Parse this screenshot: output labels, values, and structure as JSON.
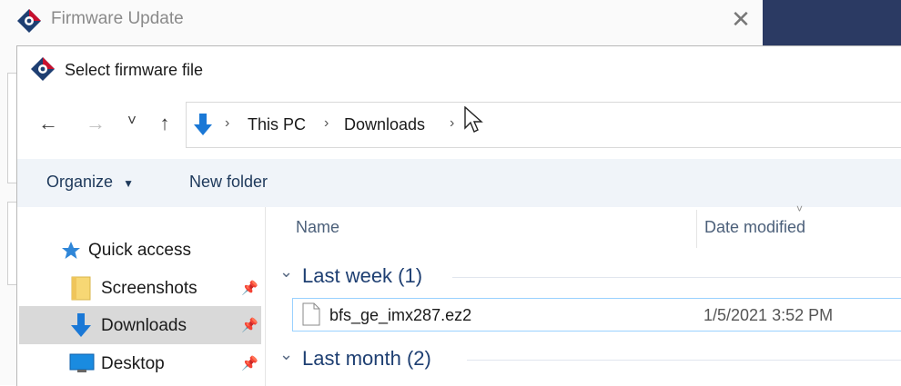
{
  "background_app": {
    "title": "Firmware Update",
    "close_glyph": "✕",
    "accent": "#c8102e"
  },
  "dialog": {
    "title": "Select firmware file",
    "nav": {
      "back": "←",
      "forward": "→",
      "recent": "˅",
      "up": "↑"
    },
    "breadcrumb": [
      "This PC",
      "Downloads"
    ],
    "toolbar": {
      "organize": "Organize",
      "new_folder": "New folder"
    },
    "nav_pane": {
      "quick_access": "Quick access",
      "items": [
        {
          "label": "Screenshots",
          "icon": "folder-icon"
        },
        {
          "label": "Downloads",
          "icon": "download-arrow-icon",
          "selected": true
        },
        {
          "label": "Desktop",
          "icon": "desktop-icon"
        }
      ]
    },
    "columns": {
      "name": "Name",
      "date_modified": "Date modified"
    },
    "groups": [
      {
        "label": "Last week (1)",
        "files": [
          {
            "name": "bfs_ge_imx287.ez2",
            "date": "1/5/2021 3:52 PM"
          }
        ]
      },
      {
        "label": "Last month (2)",
        "files": []
      }
    ]
  },
  "colors": {
    "link_blue": "#1e3f72",
    "selection": "#d9d9d9",
    "row_border": "#99d1ff",
    "download_blue": "#1a78d6"
  }
}
